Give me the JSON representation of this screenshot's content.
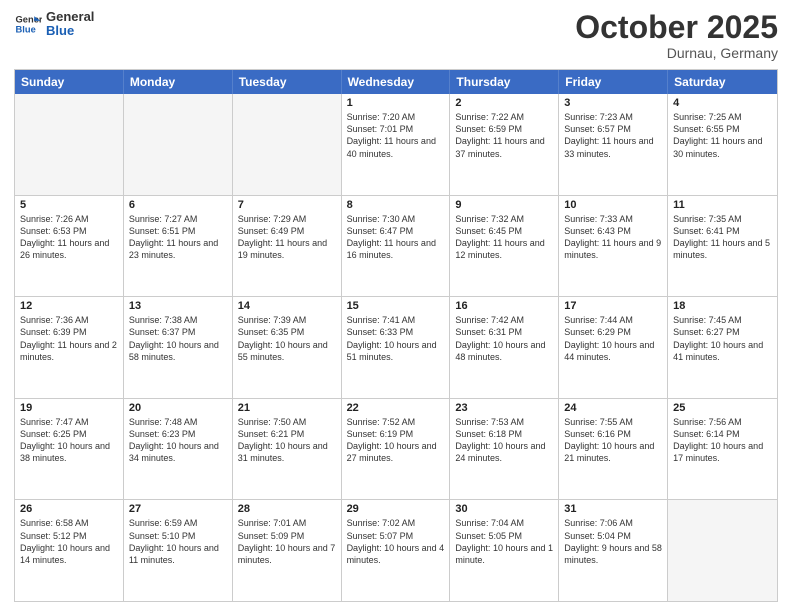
{
  "header": {
    "logo_general": "General",
    "logo_blue": "Blue",
    "month": "October 2025",
    "location": "Durnau, Germany"
  },
  "days_of_week": [
    "Sunday",
    "Monday",
    "Tuesday",
    "Wednesday",
    "Thursday",
    "Friday",
    "Saturday"
  ],
  "weeks": [
    [
      {
        "day": "",
        "text": ""
      },
      {
        "day": "",
        "text": ""
      },
      {
        "day": "",
        "text": ""
      },
      {
        "day": "1",
        "text": "Sunrise: 7:20 AM\nSunset: 7:01 PM\nDaylight: 11 hours and 40 minutes."
      },
      {
        "day": "2",
        "text": "Sunrise: 7:22 AM\nSunset: 6:59 PM\nDaylight: 11 hours and 37 minutes."
      },
      {
        "day": "3",
        "text": "Sunrise: 7:23 AM\nSunset: 6:57 PM\nDaylight: 11 hours and 33 minutes."
      },
      {
        "day": "4",
        "text": "Sunrise: 7:25 AM\nSunset: 6:55 PM\nDaylight: 11 hours and 30 minutes."
      }
    ],
    [
      {
        "day": "5",
        "text": "Sunrise: 7:26 AM\nSunset: 6:53 PM\nDaylight: 11 hours and 26 minutes."
      },
      {
        "day": "6",
        "text": "Sunrise: 7:27 AM\nSunset: 6:51 PM\nDaylight: 11 hours and 23 minutes."
      },
      {
        "day": "7",
        "text": "Sunrise: 7:29 AM\nSunset: 6:49 PM\nDaylight: 11 hours and 19 minutes."
      },
      {
        "day": "8",
        "text": "Sunrise: 7:30 AM\nSunset: 6:47 PM\nDaylight: 11 hours and 16 minutes."
      },
      {
        "day": "9",
        "text": "Sunrise: 7:32 AM\nSunset: 6:45 PM\nDaylight: 11 hours and 12 minutes."
      },
      {
        "day": "10",
        "text": "Sunrise: 7:33 AM\nSunset: 6:43 PM\nDaylight: 11 hours and 9 minutes."
      },
      {
        "day": "11",
        "text": "Sunrise: 7:35 AM\nSunset: 6:41 PM\nDaylight: 11 hours and 5 minutes."
      }
    ],
    [
      {
        "day": "12",
        "text": "Sunrise: 7:36 AM\nSunset: 6:39 PM\nDaylight: 11 hours and 2 minutes."
      },
      {
        "day": "13",
        "text": "Sunrise: 7:38 AM\nSunset: 6:37 PM\nDaylight: 10 hours and 58 minutes."
      },
      {
        "day": "14",
        "text": "Sunrise: 7:39 AM\nSunset: 6:35 PM\nDaylight: 10 hours and 55 minutes."
      },
      {
        "day": "15",
        "text": "Sunrise: 7:41 AM\nSunset: 6:33 PM\nDaylight: 10 hours and 51 minutes."
      },
      {
        "day": "16",
        "text": "Sunrise: 7:42 AM\nSunset: 6:31 PM\nDaylight: 10 hours and 48 minutes."
      },
      {
        "day": "17",
        "text": "Sunrise: 7:44 AM\nSunset: 6:29 PM\nDaylight: 10 hours and 44 minutes."
      },
      {
        "day": "18",
        "text": "Sunrise: 7:45 AM\nSunset: 6:27 PM\nDaylight: 10 hours and 41 minutes."
      }
    ],
    [
      {
        "day": "19",
        "text": "Sunrise: 7:47 AM\nSunset: 6:25 PM\nDaylight: 10 hours and 38 minutes."
      },
      {
        "day": "20",
        "text": "Sunrise: 7:48 AM\nSunset: 6:23 PM\nDaylight: 10 hours and 34 minutes."
      },
      {
        "day": "21",
        "text": "Sunrise: 7:50 AM\nSunset: 6:21 PM\nDaylight: 10 hours and 31 minutes."
      },
      {
        "day": "22",
        "text": "Sunrise: 7:52 AM\nSunset: 6:19 PM\nDaylight: 10 hours and 27 minutes."
      },
      {
        "day": "23",
        "text": "Sunrise: 7:53 AM\nSunset: 6:18 PM\nDaylight: 10 hours and 24 minutes."
      },
      {
        "day": "24",
        "text": "Sunrise: 7:55 AM\nSunset: 6:16 PM\nDaylight: 10 hours and 21 minutes."
      },
      {
        "day": "25",
        "text": "Sunrise: 7:56 AM\nSunset: 6:14 PM\nDaylight: 10 hours and 17 minutes."
      }
    ],
    [
      {
        "day": "26",
        "text": "Sunrise: 6:58 AM\nSunset: 5:12 PM\nDaylight: 10 hours and 14 minutes."
      },
      {
        "day": "27",
        "text": "Sunrise: 6:59 AM\nSunset: 5:10 PM\nDaylight: 10 hours and 11 minutes."
      },
      {
        "day": "28",
        "text": "Sunrise: 7:01 AM\nSunset: 5:09 PM\nDaylight: 10 hours and 7 minutes."
      },
      {
        "day": "29",
        "text": "Sunrise: 7:02 AM\nSunset: 5:07 PM\nDaylight: 10 hours and 4 minutes."
      },
      {
        "day": "30",
        "text": "Sunrise: 7:04 AM\nSunset: 5:05 PM\nDaylight: 10 hours and 1 minute."
      },
      {
        "day": "31",
        "text": "Sunrise: 7:06 AM\nSunset: 5:04 PM\nDaylight: 9 hours and 58 minutes."
      },
      {
        "day": "",
        "text": ""
      }
    ]
  ]
}
